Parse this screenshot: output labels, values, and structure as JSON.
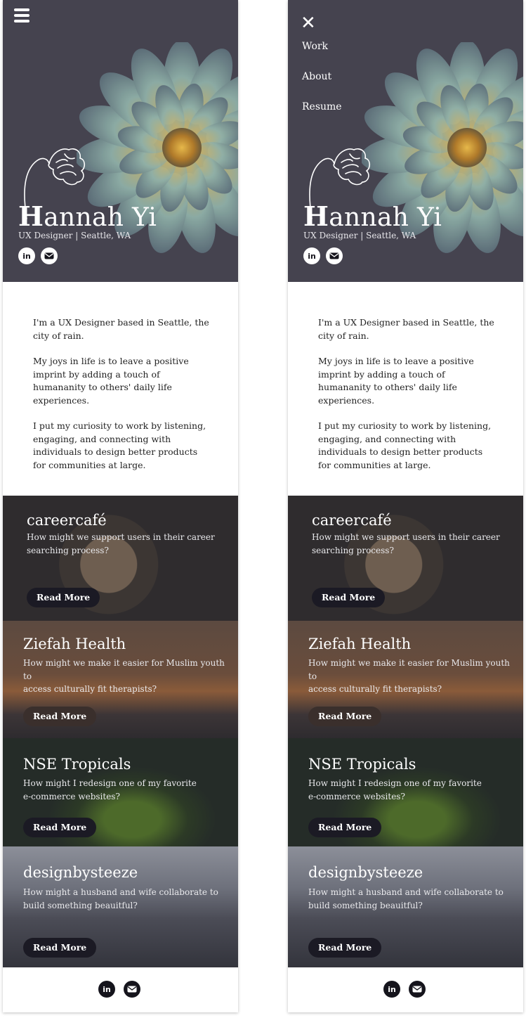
{
  "hero": {
    "name_first_letter": "H",
    "name_rest": "annah Yi",
    "tagline": "UX Designer | Seattle, WA"
  },
  "nav": {
    "items": [
      "Work",
      "About",
      "Resume"
    ]
  },
  "about": {
    "paragraphs": [
      "I'm a UX Designer based in Seattle, the city of rain.",
      "My joys in life is to leave a positive imprint by adding a touch of humananity to others' daily life experiences.",
      "I put my curiosity to work by listening, engaging, and connecting with individuals to design better products for communities at large."
    ]
  },
  "projects": [
    {
      "title": "careercafé",
      "desc_lines": [
        "How might we support users in their career",
        "searching process?"
      ],
      "button": "Read More"
    },
    {
      "title": "Ziefah Health",
      "desc_lines": [
        "How might we make it easier for Muslim youth to",
        "access culturally fit therapists?"
      ],
      "button": "Read More"
    },
    {
      "title": "NSE Tropicals",
      "desc_lines": [
        "How might I redesign one of my favorite",
        "e-commerce websites?"
      ],
      "button": "Read More"
    },
    {
      "title": "designbysteeze",
      "desc_lines": [
        "How might a husband and wife collaborate to",
        "build something beauitful?"
      ],
      "button": "Read More"
    }
  ],
  "icons": {
    "linkedin_glyph": "in",
    "linkedin": "linkedin-icon",
    "email": "email-icon",
    "menu": "hamburger-menu-icon",
    "close": "close-icon",
    "close_glyph": "✕"
  },
  "colors": {
    "hero_bg": "#45434f",
    "button_bg": "#1b1a24"
  }
}
